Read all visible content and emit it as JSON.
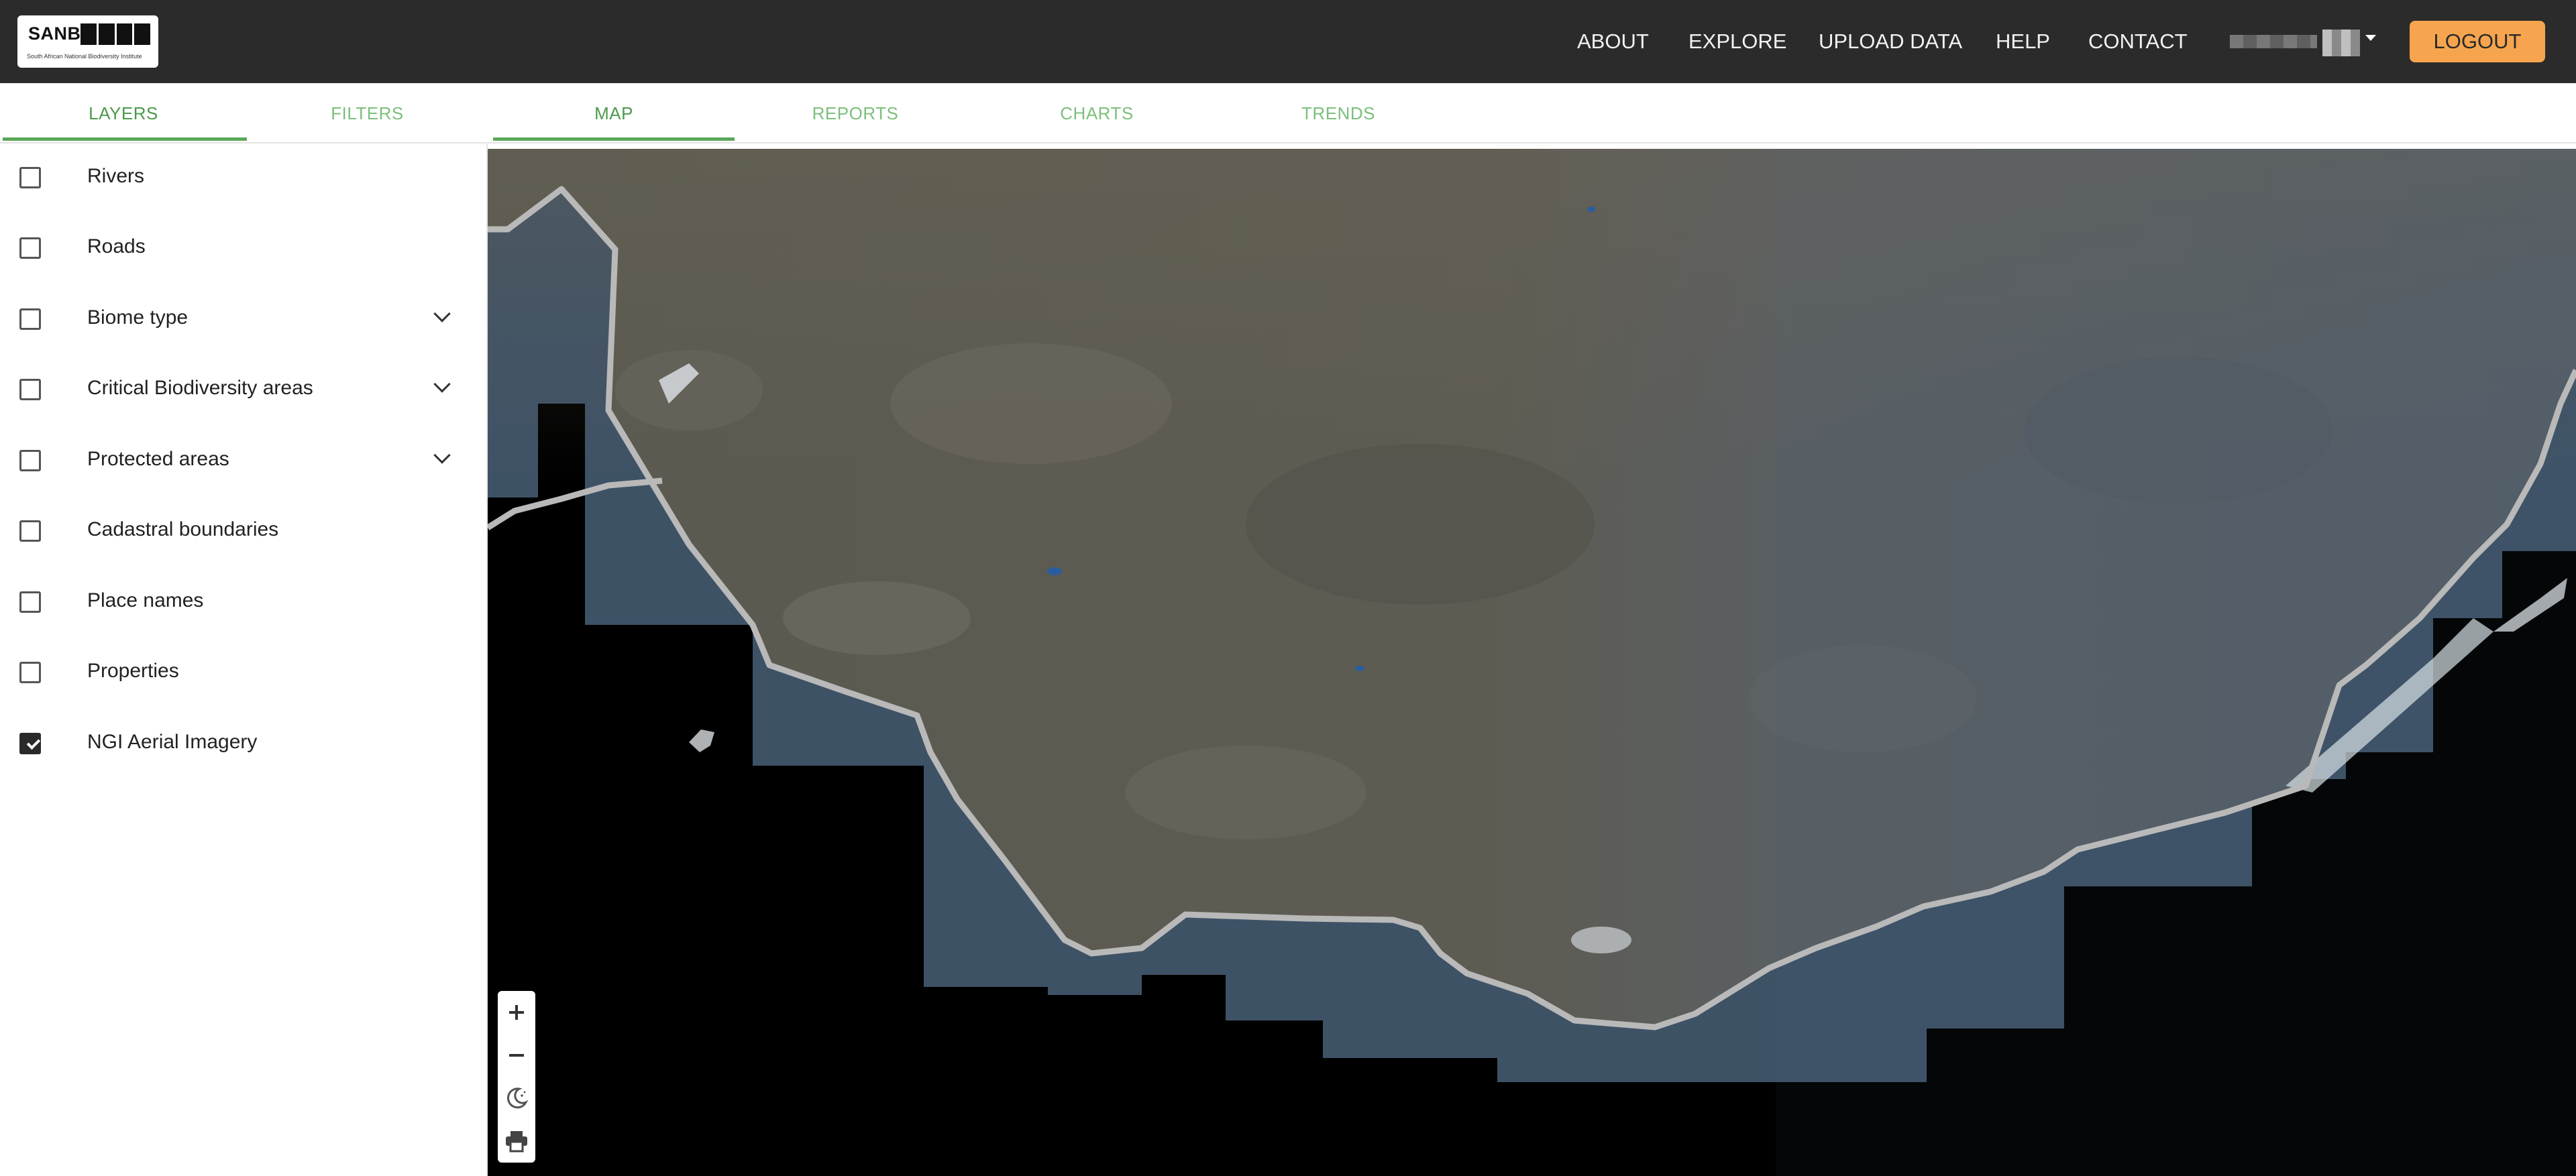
{
  "header": {
    "logo": {
      "word": "SANBI",
      "subtitle": "South African National Biodiversity Institute"
    },
    "nav": [
      "ABOUT",
      "EXPLORE",
      "UPLOAD DATA",
      "HELP",
      "CONTACT"
    ],
    "logout_label": "LOGOUT"
  },
  "sidebar": {
    "tabs": [
      "LAYERS",
      "FILTERS"
    ],
    "active_tab": "LAYERS",
    "layers": [
      {
        "label": "Rivers",
        "checked": false,
        "expandable": false
      },
      {
        "label": "Roads",
        "checked": false,
        "expandable": false
      },
      {
        "label": "Biome type",
        "checked": false,
        "expandable": true
      },
      {
        "label": "Critical Biodiversity areas",
        "checked": false,
        "expandable": true
      },
      {
        "label": "Protected areas",
        "checked": false,
        "expandable": true
      },
      {
        "label": "Cadastral boundaries",
        "checked": false,
        "expandable": false
      },
      {
        "label": "Place names",
        "checked": false,
        "expandable": false
      },
      {
        "label": "Properties",
        "checked": false,
        "expandable": false
      },
      {
        "label": "NGI Aerial Imagery",
        "checked": true,
        "expandable": false
      }
    ]
  },
  "main": {
    "tabs": [
      "MAP",
      "REPORTS",
      "CHARTS",
      "TRENDS"
    ],
    "active_tab": "MAP"
  },
  "map_controls": [
    "zoom-in-icon",
    "zoom-out-icon",
    "dark-mode-icon",
    "print-icon"
  ],
  "colors": {
    "topbar": "#2b2b2b",
    "accent_green": "#5aa85a",
    "logout": "#f6a54e",
    "land": "#5b5a52",
    "sea": "#000000",
    "coastline": "#b8b8b8"
  }
}
